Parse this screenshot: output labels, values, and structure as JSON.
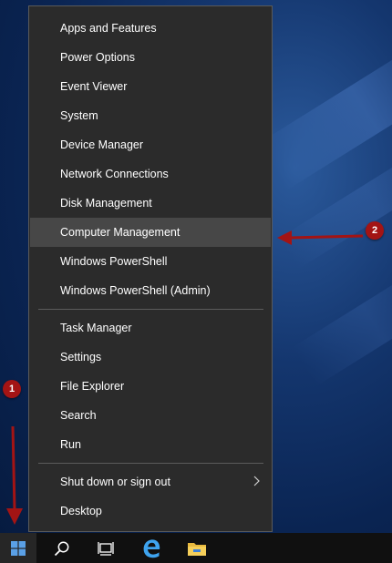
{
  "menu": {
    "group1": [
      {
        "label": "Apps and Features",
        "name": "menu-item-apps-and-features"
      },
      {
        "label": "Power Options",
        "name": "menu-item-power-options"
      },
      {
        "label": "Event Viewer",
        "name": "menu-item-event-viewer"
      },
      {
        "label": "System",
        "name": "menu-item-system"
      },
      {
        "label": "Device Manager",
        "name": "menu-item-device-manager"
      },
      {
        "label": "Network Connections",
        "name": "menu-item-network-connections"
      },
      {
        "label": "Disk Management",
        "name": "menu-item-disk-management"
      },
      {
        "label": "Computer Management",
        "name": "menu-item-computer-management"
      },
      {
        "label": "Windows PowerShell",
        "name": "menu-item-windows-powershell"
      },
      {
        "label": "Windows PowerShell (Admin)",
        "name": "menu-item-windows-powershell-admin"
      }
    ],
    "group2": [
      {
        "label": "Task Manager",
        "name": "menu-item-task-manager"
      },
      {
        "label": "Settings",
        "name": "menu-item-settings"
      },
      {
        "label": "File Explorer",
        "name": "menu-item-file-explorer"
      },
      {
        "label": "Search",
        "name": "menu-item-search"
      },
      {
        "label": "Run",
        "name": "menu-item-run"
      }
    ],
    "group3": [
      {
        "label": "Shut down or sign out",
        "name": "menu-item-shut-down-or-sign-out"
      },
      {
        "label": "Desktop",
        "name": "menu-item-desktop"
      }
    ],
    "highlighted": "Computer Management"
  },
  "annotations": {
    "badge1": "1",
    "badge2": "2",
    "color": "#a31414"
  },
  "taskbar": {
    "icons": [
      "windows-start-icon",
      "search-icon",
      "task-view-icon",
      "edge-icon",
      "file-explorer-icon"
    ]
  }
}
